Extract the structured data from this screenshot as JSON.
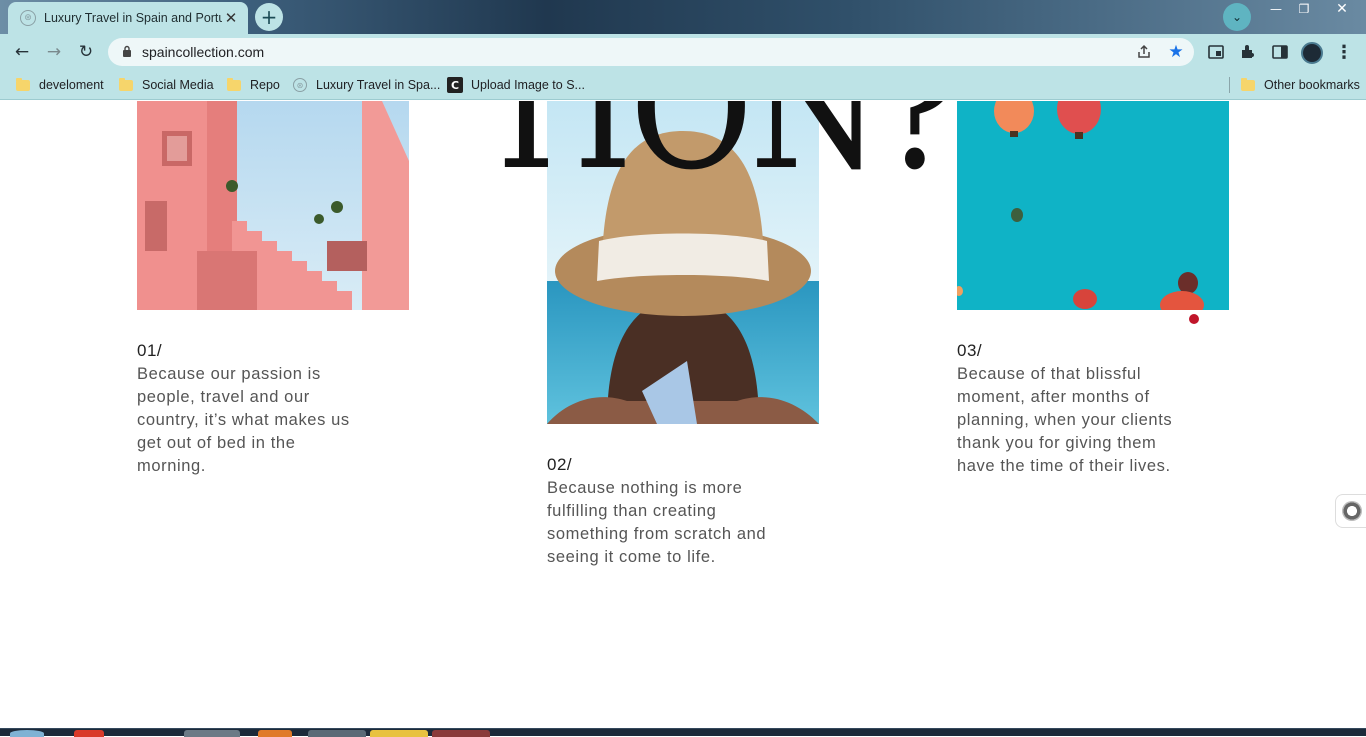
{
  "browser": {
    "tab": {
      "title": "Luxury Travel in Spain and Portugal",
      "close_glyph": "✕"
    },
    "new_tab_glyph": "+",
    "tab_search_glyph": "⌄",
    "window_controls": {
      "minimize": "—",
      "maximize": "❐",
      "close": "✕"
    },
    "nav": {
      "back": "←",
      "forward": "→",
      "reload": "↻"
    },
    "url": "spaincollection.com",
    "bookmarks": [
      {
        "label": "develoment",
        "type": "folder"
      },
      {
        "label": "Social Media",
        "type": "folder"
      },
      {
        "label": "Repo",
        "type": "folder"
      },
      {
        "label": "Luxury Travel in Spa...",
        "type": "site"
      },
      {
        "label": "Upload Image to S...",
        "type": "site-c"
      }
    ],
    "other_bookmarks": "Other bookmarks",
    "colors": {
      "chrome": "#bde3e6",
      "star": "#1a73e8"
    },
    "icons": [
      "share-icon",
      "star-icon",
      "pip-icon",
      "extensions-icon",
      "sidepanel-icon",
      "profile-avatar",
      "menu-icon"
    ]
  },
  "page": {
    "headline_fragment": "TION?",
    "items": [
      {
        "number": "01/",
        "text": "Because our passion is people, travel and our country, it’s what makes us get out of bed in the morning."
      },
      {
        "number": "02/",
        "text": "Because nothing is more fulfilling than creating something from scratch and seeing it come to life."
      },
      {
        "number": "03/",
        "text": "Because of that blissful moment, after months of planning, when your clients thank you for giving them have the time of their lives."
      }
    ],
    "colors": {
      "accent_dot": "#c0152a",
      "text": "#555555"
    }
  }
}
